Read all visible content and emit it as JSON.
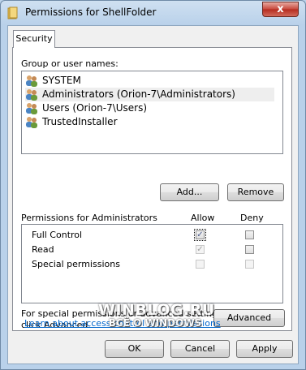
{
  "window": {
    "title": "Permissions for ShellFolder",
    "close_glyph": "x"
  },
  "tab": {
    "label": "Security"
  },
  "users": {
    "label": "Group or user names:",
    "items": [
      {
        "name": "SYSTEM",
        "icon": "users-group-icon"
      },
      {
        "name": "Administrators (Orion-7\\Administrators)",
        "icon": "users-group-icon",
        "selected": true
      },
      {
        "name": "Users (Orion-7\\Users)",
        "icon": "users-group-icon"
      },
      {
        "name": "TrustedInstaller",
        "icon": "users-group-icon"
      }
    ]
  },
  "buttons": {
    "add": "Add...",
    "remove": "Remove",
    "advanced": "Advanced",
    "ok": "OK",
    "cancel": "Cancel",
    "apply": "Apply"
  },
  "permissions": {
    "label": "Permissions for Administrators",
    "allow_header": "Allow",
    "deny_header": "Deny",
    "rows": [
      {
        "name": "Full Control",
        "allow": true,
        "deny": false
      },
      {
        "name": "Read",
        "allow": true,
        "deny": false
      },
      {
        "name": "Special permissions",
        "allow": false,
        "deny": false
      }
    ]
  },
  "advanced_note": {
    "line1": "For special permissions or advanced settings,",
    "line2": "click Advanced."
  },
  "learn_link": "Learn about access control and permissions",
  "watermark": {
    "line1": "WINBLOG.RU",
    "line2": "ВСЁ О WINDOWS"
  }
}
